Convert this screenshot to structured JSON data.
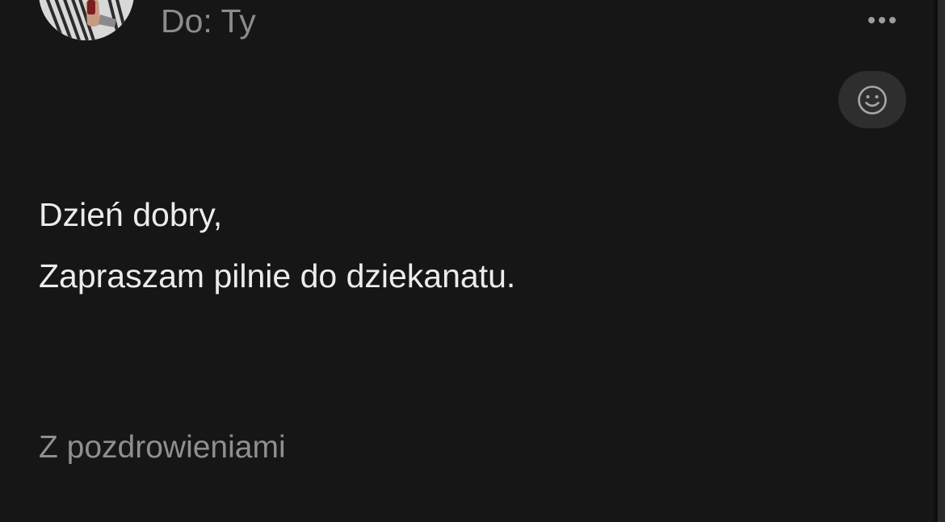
{
  "header": {
    "to_line": "Do: Ty"
  },
  "icons": {
    "more": "more-horizontal-icon",
    "react": "smiley-icon",
    "avatar": "sender-avatar"
  },
  "message": {
    "greeting": "Dzień dobry,",
    "body": "Zapraszam pilnie do dziekanatu.",
    "signature": "Z pozdrowieniami"
  },
  "colors": {
    "background": "#161616",
    "primary_text": "#ececec",
    "secondary_text": "#8c8c8c",
    "button_bg": "#2e2e2e"
  }
}
